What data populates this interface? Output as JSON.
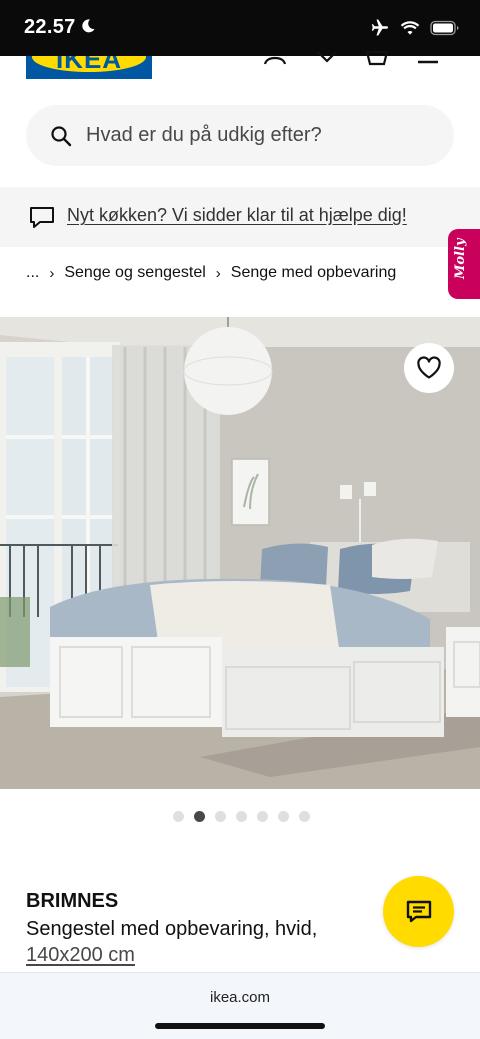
{
  "status_bar": {
    "time": "22.57",
    "icons": [
      "moon-icon",
      "airplane-icon",
      "wifi-icon",
      "battery-icon"
    ]
  },
  "header": {
    "logo_text": "IKEA",
    "icons": [
      "user-icon",
      "heart-icon",
      "bag-icon",
      "menu-icon"
    ]
  },
  "search": {
    "placeholder": "Hvad er du på udkig efter?"
  },
  "promo": {
    "text": "Nyt køkken? Vi sidder klar til at hjælpe dig!"
  },
  "molly": {
    "label": "Molly"
  },
  "breadcrumb": {
    "items": [
      "...",
      "Senge og sengestel",
      "Senge med opbevaring"
    ],
    "separator": "›"
  },
  "gallery": {
    "dot_count": 7,
    "active_index": 1
  },
  "product": {
    "name": "BRIMNES",
    "description": "Sengestel med opbevaring, hvid, ",
    "size": "140x200 cm"
  },
  "browser": {
    "url": "ikea.com"
  },
  "colors": {
    "ikea_blue": "#0058a3",
    "ikea_yellow": "#ffdb00",
    "molly_pink": "#ca005d"
  }
}
